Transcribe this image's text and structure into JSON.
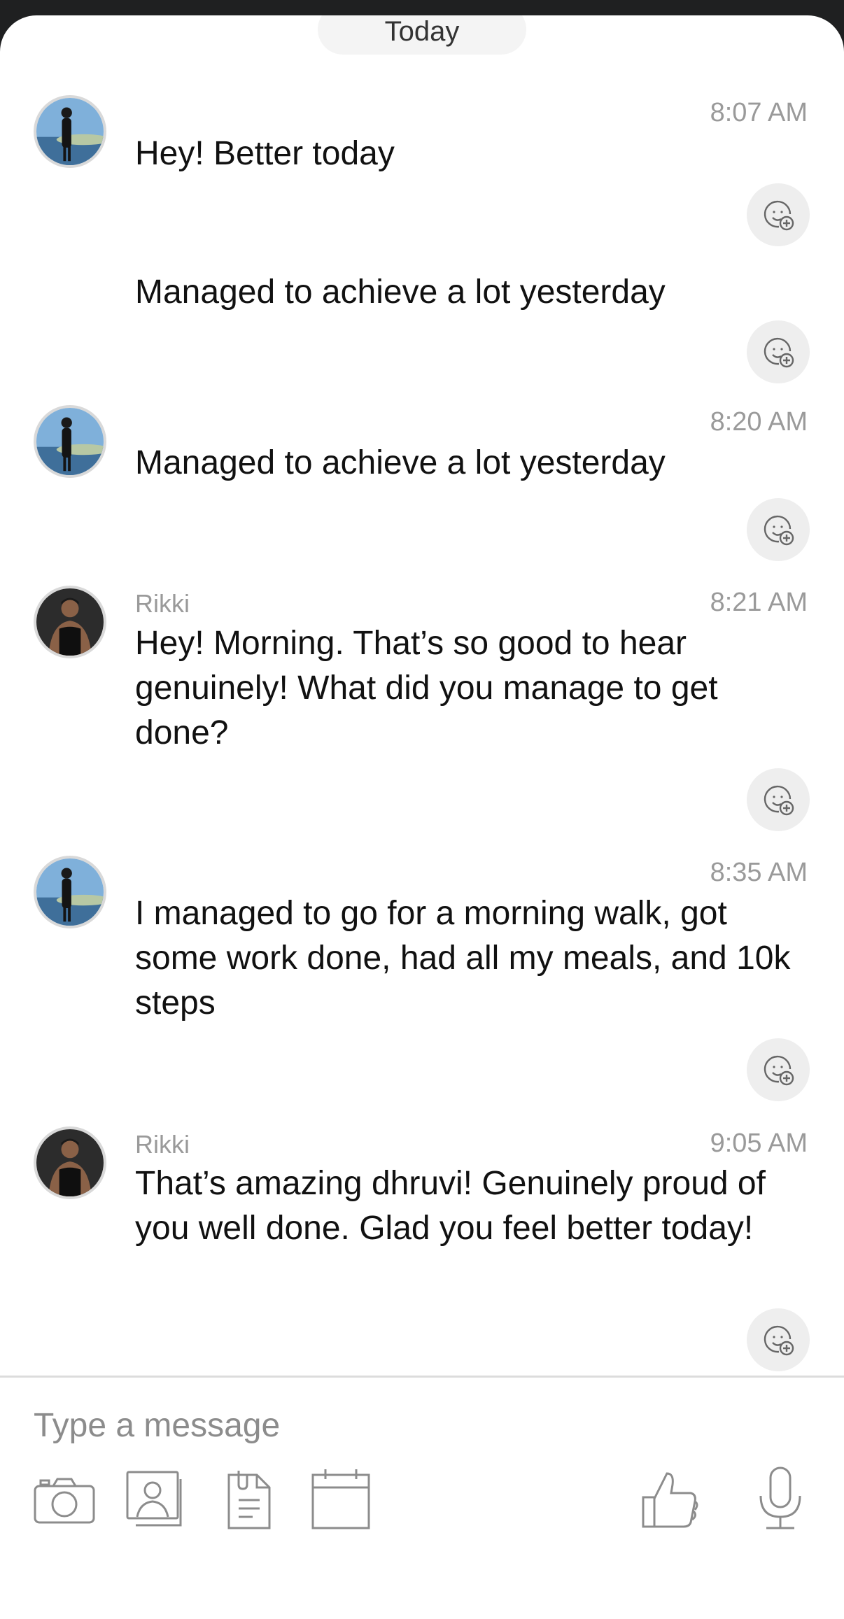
{
  "header": {
    "date_label": "Today"
  },
  "messages": [
    {
      "sender": "",
      "time": "8:07 AM",
      "text": "Hey! Better today",
      "avatar": "user-avatar-beach"
    },
    {
      "sender": "",
      "time": "",
      "text": "Managed to achieve a lot yesterday",
      "avatar": ""
    },
    {
      "sender": "",
      "time": "8:20 AM",
      "text": "Managed to achieve a lot yesterday",
      "avatar": "user-avatar-beach"
    },
    {
      "sender": "Rikki",
      "time": "8:21 AM",
      "text": "Hey! Morning. That’s so good to hear genuinely! What did you manage to get done?",
      "avatar": "rikki-avatar"
    },
    {
      "sender": "",
      "time": "8:35 AM",
      "text": "I managed to go for a morning walk, got some work done, had all my meals, and 10k steps",
      "avatar": "user-avatar-beach"
    },
    {
      "sender": "Rikki",
      "time": "9:05 AM",
      "text": "That’s amazing dhruvi! Genuinely proud of you well done. Glad you feel better today!",
      "avatar": "rikki-avatar"
    }
  ],
  "composer": {
    "placeholder": "Type a message",
    "tools": [
      "camera-icon",
      "gallery-icon",
      "document-icon",
      "calendar-icon",
      "thumbs-up-icon",
      "microphone-icon"
    ]
  },
  "colors": {
    "meta_text": "#9a9a9a",
    "message_text": "#111111",
    "divider": "#dcdcdc",
    "react_bg": "#eeeeee"
  }
}
